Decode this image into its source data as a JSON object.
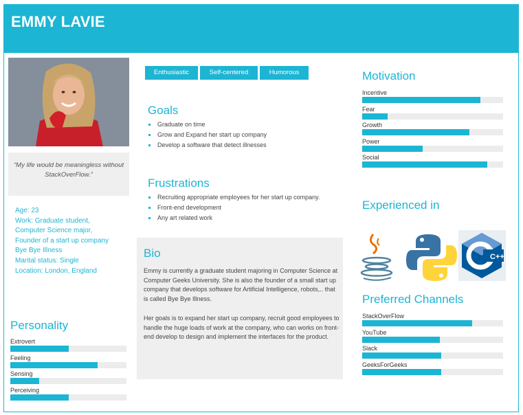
{
  "header": {
    "name": "EMMY LAVIE"
  },
  "quote": "“My life would be meaningless without StackOverFlow.”",
  "info": [
    "Age: 23",
    "Work: Graduate student,",
    "Computer Science major,",
    "Founder of a start up company",
    "Bye Bye Illness",
    "Marital status: Single",
    "Location: London, England"
  ],
  "tags": [
    "Enthusiastic",
    "Self-centered",
    "Humorous"
  ],
  "goals": {
    "title": "Goals",
    "items": [
      "Graduate on time",
      "Grow and Expand her start up company",
      "Develop a software that detect illnesses"
    ]
  },
  "frustrations": {
    "title": "Frustrations",
    "items": [
      "Recruiting appropriate employees for her start up company.",
      "Front-end development",
      "Any art related work"
    ]
  },
  "bio": {
    "title": "Bio",
    "paragraph1": "Emmy is currently a graduate student majoring in Computer Science at Computer Geeks University. She is also the founder of a small start up company that develops software for Artificial Intelligence, robots,.. that is called Bye Bye Illness.",
    "paragraph2": "Her goals is to expand her start up company, recruit good employees to handle the huge loads of work at the company, who can works on front-end develop to design and implement the interfaces for the product."
  },
  "personality": {
    "title": "Personality",
    "traits": [
      {
        "label": "Extrovert",
        "value": 0.5
      },
      {
        "label": "Feeling",
        "value": 0.75
      },
      {
        "label": "Sensing",
        "value": 0.25
      },
      {
        "label": "Perceiving",
        "value": 0.5
      }
    ]
  },
  "motivation": {
    "title": "Motivation",
    "items": [
      {
        "label": "Incentive",
        "value": 0.84
      },
      {
        "label": "Fear",
        "value": 0.18
      },
      {
        "label": "Growth",
        "value": 0.76
      },
      {
        "label": "Power",
        "value": 0.43
      },
      {
        "label": "Social",
        "value": 0.89
      }
    ]
  },
  "experienced": {
    "title": "Experienced in",
    "logos": [
      "java-logo",
      "python-logo",
      "cpp-logo"
    ],
    "cpp_text": "C++"
  },
  "channels": {
    "title": "Preferred Channels",
    "items": [
      {
        "label": "StackOverFlow",
        "value": 0.78
      },
      {
        "label": "YouTube",
        "value": 0.55
      },
      {
        "label": "Slack",
        "value": 0.56
      },
      {
        "label": "GeeksForGeeks",
        "value": 0.56
      }
    ]
  },
  "colors": {
    "accent": "#1cb5d4",
    "panel": "#efefef",
    "track": "#ececec"
  }
}
